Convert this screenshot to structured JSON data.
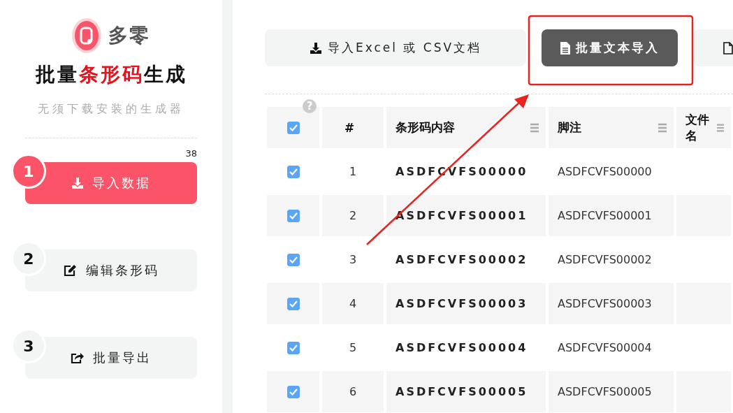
{
  "brand": {
    "name": "多零"
  },
  "title_parts": [
    {
      "text": "批量",
      "highlight": false
    },
    {
      "text": "条形码",
      "highlight": true
    },
    {
      "text": "生成",
      "highlight": false
    }
  ],
  "subtitle": "无须下载安装的生成器",
  "steps": [
    {
      "number": "1",
      "label": "导入数据",
      "selected": true,
      "count": "38"
    },
    {
      "number": "2",
      "label": "编辑条形码",
      "selected": false
    },
    {
      "number": "3",
      "label": "批量导出",
      "selected": false
    }
  ],
  "toolbar": [
    {
      "label": "导入Excel 或 CSV文档",
      "selected": false
    },
    {
      "label": "批量文本导入",
      "selected": true
    },
    {
      "selected": false
    }
  ],
  "table": {
    "help": "?",
    "select_all_checked": true,
    "columns": [
      {
        "label": "#",
        "menu": false
      },
      {
        "label": "条形码内容",
        "menu": true
      },
      {
        "label": "脚注",
        "menu": true
      },
      {
        "label": "文件名",
        "menu": true
      }
    ],
    "rows": [
      {
        "checked": true,
        "number": "1",
        "content": "ASDFCVFS00000",
        "note": "ASDFCVFS00000"
      },
      {
        "checked": true,
        "number": "2",
        "content": "ASDFCVFS00001",
        "note": "ASDFCVFS00001"
      },
      {
        "checked": true,
        "number": "3",
        "content": "ASDFCVFS00002",
        "note": "ASDFCVFS00002"
      },
      {
        "checked": true,
        "number": "4",
        "content": "ASDFCVFS00003",
        "note": "ASDFCVFS00003"
      },
      {
        "checked": true,
        "number": "5",
        "content": "ASDFCVFS00004",
        "note": "ASDFCVFS00004"
      },
      {
        "checked": true,
        "number": "6",
        "content": "ASDFCVFS00005",
        "note": "ASDFCVFS00005"
      }
    ]
  }
}
